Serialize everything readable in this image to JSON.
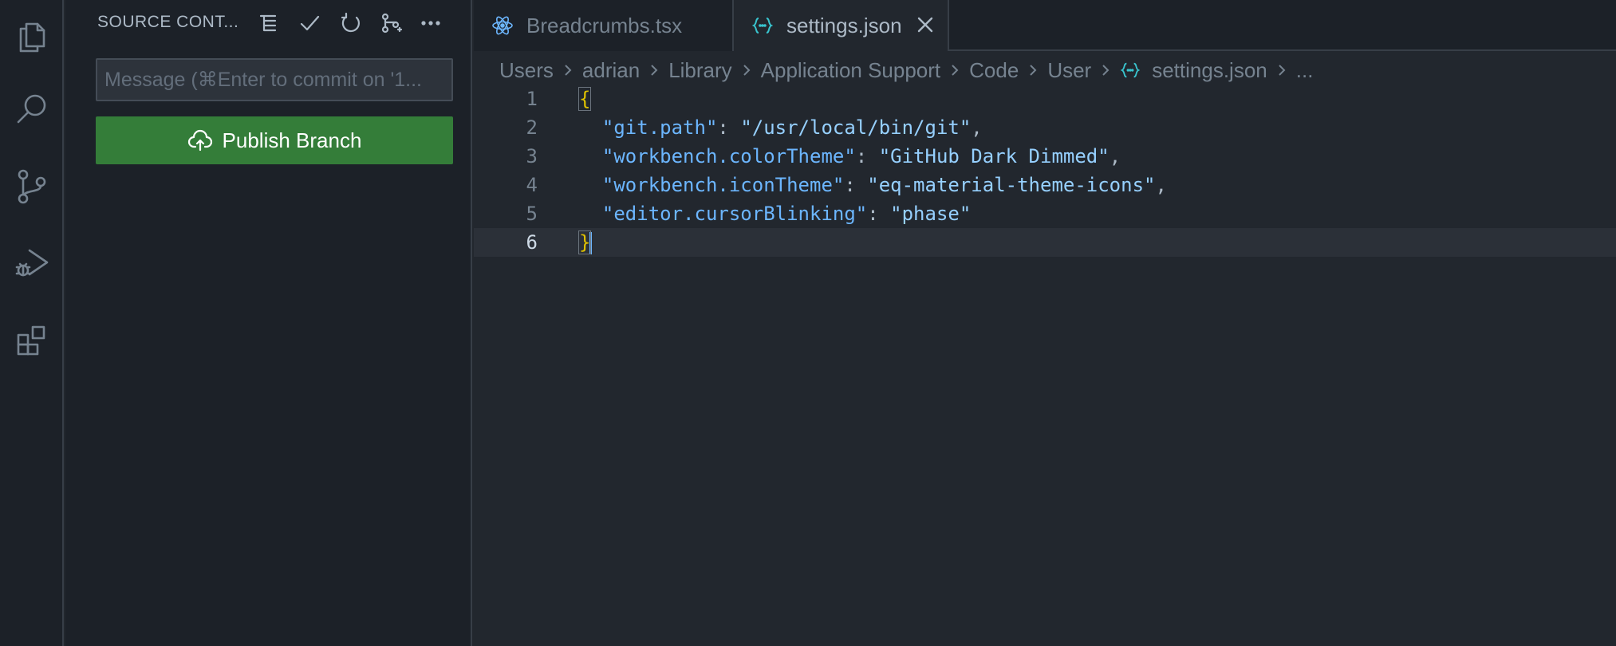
{
  "activity_bar": {
    "items": [
      {
        "name": "explorer",
        "icon": "files-icon"
      },
      {
        "name": "search",
        "icon": "search-icon"
      },
      {
        "name": "source-control",
        "icon": "source-control-icon"
      },
      {
        "name": "run-debug",
        "icon": "run-debug-icon"
      },
      {
        "name": "extensions",
        "icon": "extensions-icon"
      }
    ]
  },
  "sidebar": {
    "title": "SOURCE CONT...",
    "commit_placeholder": "Message (⌘Enter to commit on '1...",
    "publish_label": "Publish Branch",
    "header_icons": [
      "tree-view-icon",
      "check-icon",
      "refresh-icon",
      "branch-graph-icon",
      "more-icon"
    ]
  },
  "tabs": [
    {
      "label": "Breadcrumbs.tsx",
      "icon": "react-icon",
      "active": false
    },
    {
      "label": "settings.json",
      "icon": "json-icon",
      "active": true
    }
  ],
  "breadcrumb": {
    "parts": [
      "Users",
      "adrian",
      "Library",
      "Application Support",
      "Code",
      "User",
      "settings.json",
      "..."
    ]
  },
  "editor": {
    "lines": [
      {
        "n": "1",
        "text": "{"
      },
      {
        "n": "2",
        "key": "\"git.path\"",
        "value": "\"/usr/local/bin/git\"",
        "trail": ","
      },
      {
        "n": "3",
        "key": "\"workbench.colorTheme\"",
        "value": "\"GitHub Dark Dimmed\"",
        "trail": ","
      },
      {
        "n": "4",
        "key": "\"workbench.iconTheme\"",
        "value": "\"eq-material-theme-icons\"",
        "trail": ","
      },
      {
        "n": "5",
        "key": "\"editor.cursorBlinking\"",
        "value": "\"phase\"",
        "trail": ""
      },
      {
        "n": "6",
        "text": "}"
      }
    ],
    "current_line": 6
  },
  "colors": {
    "accent": "#6cb6ff",
    "publish_button": "#347d39",
    "brace": "#e0c200"
  }
}
